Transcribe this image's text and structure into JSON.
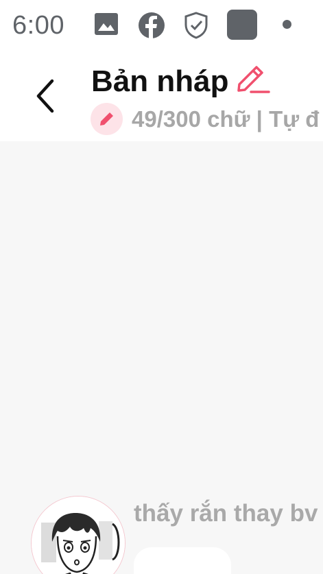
{
  "status_bar": {
    "time": "6:00",
    "icons": [
      "image-icon",
      "facebook-icon",
      "shield-check-icon",
      "app-square-icon",
      "notification-dot-icon"
    ]
  },
  "header": {
    "title": "Bản nháp",
    "meta": "49/300 chữ | Tự đ"
  },
  "chat": {
    "message_preview": "thấy rắn thay bv"
  },
  "colors": {
    "accent": "#f0506e",
    "badge_bg": "#fde3e8",
    "muted_text": "#a7a7a7",
    "content_bg": "#f7f7f7"
  }
}
